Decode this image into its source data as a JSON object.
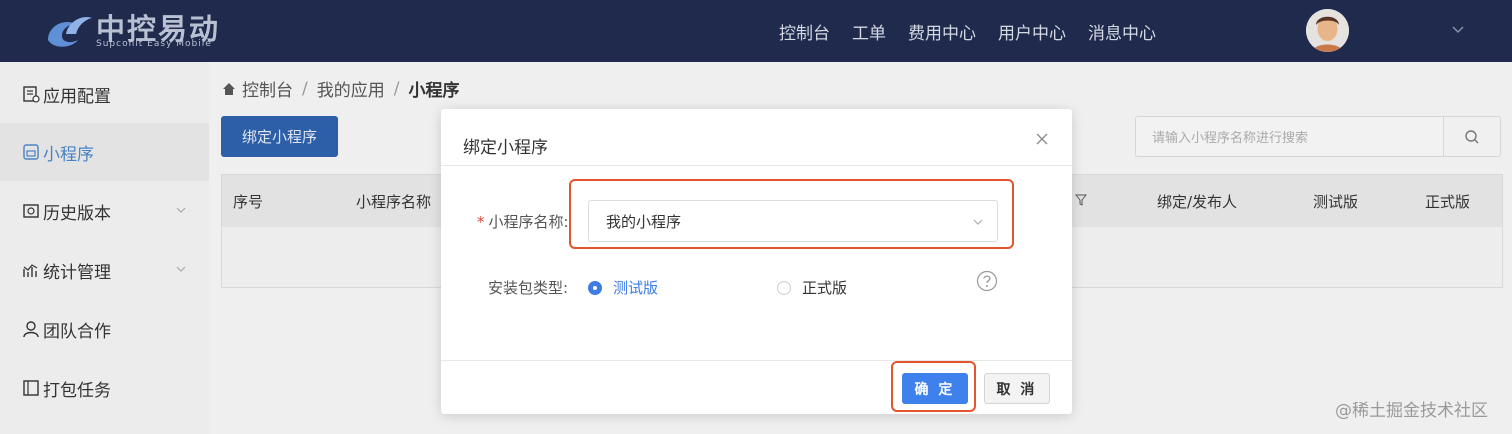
{
  "header": {
    "logo_text": "中控易动",
    "logo_sub": "Supconit Easy Mobile",
    "nav": [
      "控制台",
      "工单",
      "费用中心",
      "用户中心",
      "消息中心"
    ]
  },
  "sidebar": {
    "items": [
      {
        "label": "应用配置",
        "icon": "config-icon"
      },
      {
        "label": "小程序",
        "icon": "miniprogram-icon"
      },
      {
        "label": "历史版本",
        "icon": "history-icon"
      },
      {
        "label": "统计管理",
        "icon": "stats-icon"
      },
      {
        "label": "团队合作",
        "icon": "team-icon"
      },
      {
        "label": "打包任务",
        "icon": "package-icon"
      }
    ]
  },
  "breadcrumb": [
    "控制台",
    "我的应用",
    "小程序"
  ],
  "toolbar": {
    "bind_label": "绑定小程序",
    "search_placeholder": "请输入小程序名称进行搜索"
  },
  "table": {
    "columns": [
      "序号",
      "小程序名称",
      "绑定/发布人",
      "测试版",
      "正式版"
    ]
  },
  "modal": {
    "title": "绑定小程序",
    "name_label": "小程序名称:",
    "name_value": "我的小程序",
    "type_label": "安装包类型:",
    "type_options": [
      "测试版",
      "正式版"
    ],
    "selected_type": "测试版",
    "ok_label": "确 定",
    "cancel_label": "取 消"
  },
  "watermark": "@稀土掘金技术社区",
  "colors": {
    "header_bg": "#1f2a4d",
    "primary": "#3e80ec",
    "highlight": "#e4542f",
    "sidebar_active": "#4a83c4"
  }
}
